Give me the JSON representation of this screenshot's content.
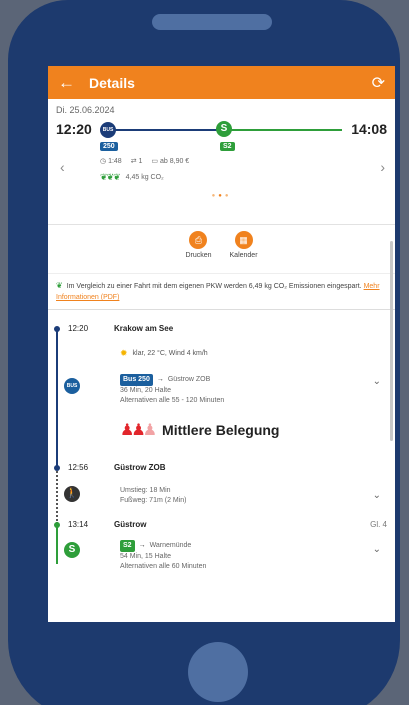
{
  "header": {
    "title": "Details"
  },
  "date": "Di. 25.06.2024",
  "overview": {
    "departure": "12:20",
    "arrival": "14:08",
    "bus_icon": "BUS",
    "s_icon": "S",
    "bus_tag": "250",
    "s_tag": "S2",
    "duration": "1:48",
    "transfers": "1",
    "price": "ab 8,90 €",
    "co2": "4,45 kg CO₂"
  },
  "actions": [
    {
      "label": "Drucken",
      "icon": "print-icon"
    },
    {
      "label": "Kalender",
      "icon": "calendar-icon"
    }
  ],
  "eco": {
    "text": "Im Vergleich zu einer Fahrt mit dem eigenen PKW werden 6,49 kg CO₂ Emissionen eingespart.",
    "link": "Mehr Informationen (PDF)"
  },
  "stops": [
    {
      "time": "12:20",
      "name": "Krakow am See",
      "platform": ""
    },
    {
      "time": "12:56",
      "name": "Güstrow ZOB",
      "platform": ""
    },
    {
      "time": "13:14",
      "name": "Güstrow",
      "platform": "Gl. 4"
    }
  ],
  "weather": "klar, 22 °C, Wind 4 km/h",
  "legs": {
    "bus": {
      "icon": "BUS",
      "line": "Bus 250",
      "destination": "Güstrow ZOB",
      "info": "36 Min, 20 Halte",
      "alternatives": "Alternativen alle 55 - 120 Minuten",
      "occupancy": "Mittlere Belegung"
    },
    "walk": {
      "transfer": "Umstieg: 18 Min",
      "footpath": "Fußweg: 71m (2 Min)"
    },
    "train": {
      "icon": "S",
      "line": "S2",
      "destination": "Warnemünde",
      "info": "54 Min, 15 Halte",
      "alternatives": "Alternativen alle 60 Minuten"
    }
  },
  "colors": {
    "accent": "#f0821e",
    "bus": "#1b3c78",
    "sbahn": "#2e9e3a",
    "occupancy": "#e2262c"
  }
}
